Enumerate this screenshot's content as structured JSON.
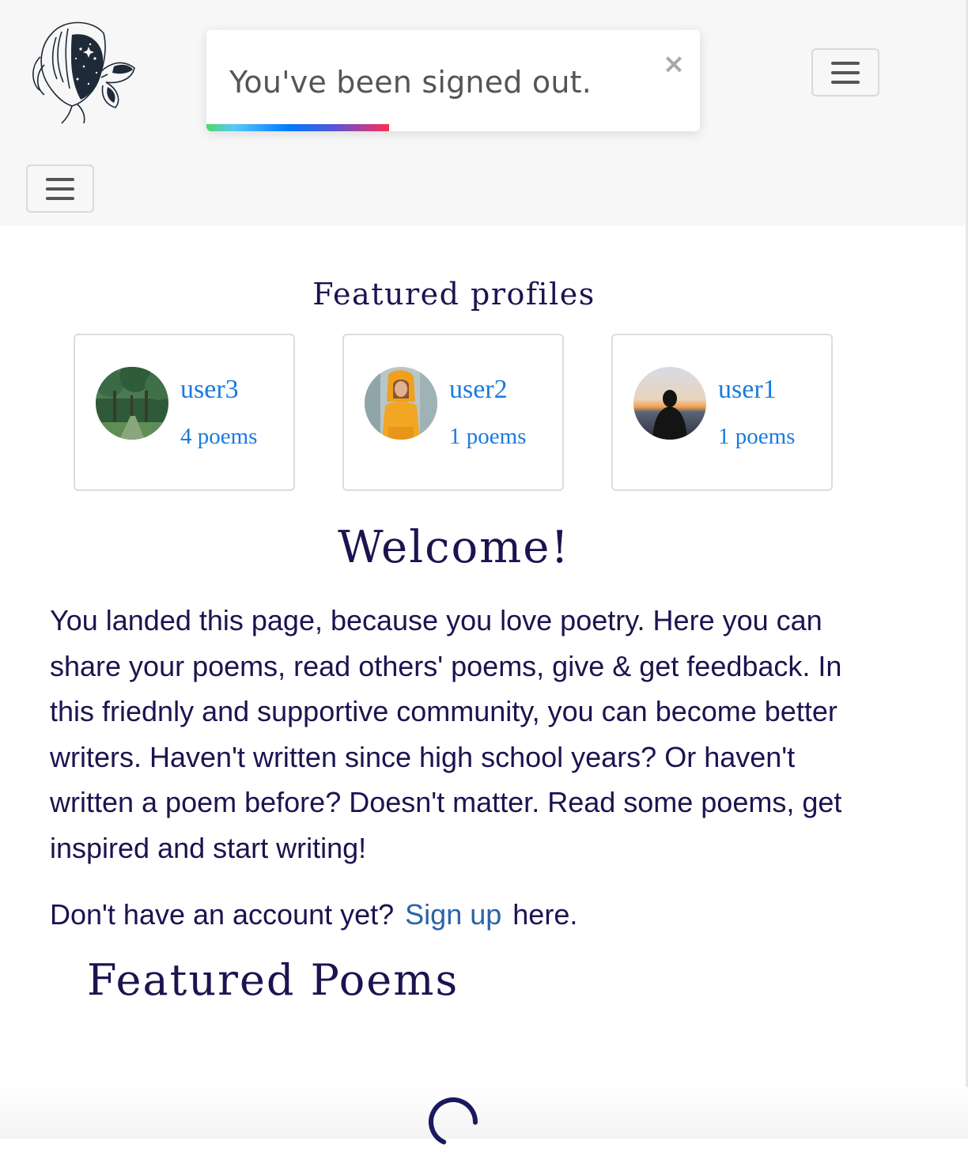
{
  "header": {
    "logo_icon": "butterfly-woman-illustration-icon",
    "menu_icon": "hamburger-menu-icon"
  },
  "toast": {
    "message": "You've been signed out.",
    "close_label": "×",
    "progress": 0.37
  },
  "featured_profiles": {
    "title": "Featured profiles",
    "profiles": [
      {
        "username": "user3",
        "poems": "4 poems",
        "avatar": "forest-trees-photo"
      },
      {
        "username": "user2",
        "poems": "1 poems",
        "avatar": "person-yellow-hoodie-photo"
      },
      {
        "username": "user1",
        "poems": "1 poems",
        "avatar": "person-sunset-silhouette-photo"
      }
    ]
  },
  "welcome": {
    "title": "Welcome!",
    "body": "You landed this page, because you love poetry. Here you can share your poems, read others' poems, give & get feedback. In this friednly and supportive community, you can become better writers. Haven't written since high school years? Or haven't written a poem before? Doesn't matter. Read some poems, get inspired and start writing!",
    "signup_prefix": "Don't have an account yet?",
    "signup_link": "Sign up",
    "signup_suffix": "here."
  },
  "featured_poems": {
    "title": "Featured Poems",
    "loading_icon": "loading-spinner-icon"
  },
  "colors": {
    "header_bg": "#f7f7f7",
    "heading_navy": "#1a1450",
    "link_blue": "#1a7be0",
    "signup_link": "#2a63a8"
  }
}
